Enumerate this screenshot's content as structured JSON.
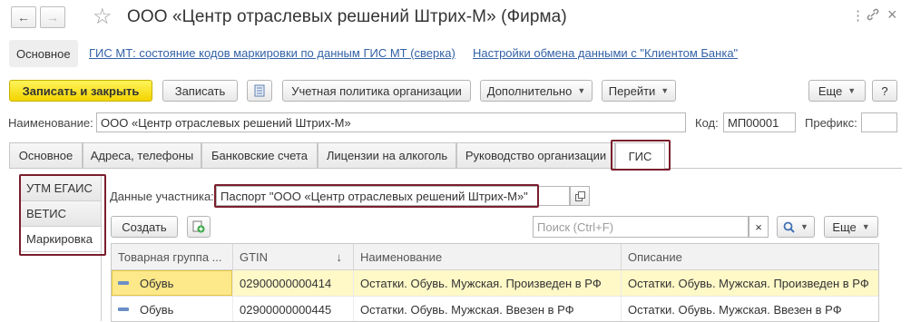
{
  "window": {
    "title": "ООО «Центр отраслевых решений Штрих-М» (Фирма)"
  },
  "sections": {
    "main": "Основное",
    "links": [
      "ГИС МТ: состояние кодов маркировки по данным ГИС МТ (сверка)",
      "Настройки обмена данными с \"Клиентом Банка\""
    ]
  },
  "toolbar": {
    "save_close": "Записать и закрыть",
    "save": "Записать",
    "accounting_policy": "Учетная политика организации",
    "more": "Дополнительно",
    "goto": "Перейти",
    "etc": "Еще",
    "help": "?"
  },
  "form": {
    "name_label": "Наименование:",
    "name_value": "ООО «Центр отраслевых решений Штрих-М»",
    "code_label": "Код:",
    "code_value": "МП00001",
    "prefix_label": "Префикс:",
    "prefix_value": ""
  },
  "tabs": [
    "Основное",
    "Адреса, телефоны",
    "Банковские счета",
    "Лицензии на алкоголь",
    "Руководство организации",
    "ГИС"
  ],
  "vtabs": [
    "УТМ ЕГАИС",
    "ВЕТИС",
    "Маркировка"
  ],
  "participant": {
    "label": "Данные участника:",
    "value": "Паспорт \"ООО «Центр отраслевых решений Штрих-М»\""
  },
  "list_toolbar": {
    "create": "Создать",
    "search_placeholder": "Поиск (Ctrl+F)",
    "etc": "Еще"
  },
  "table": {
    "columns": [
      "Товарная группа ...",
      "GTIN",
      "Наименование",
      "Описание"
    ],
    "sort_indicator": "↓",
    "rows": [
      [
        "Обувь",
        "02900000000414",
        "Остатки. Обувь. Мужская. Произведен в РФ",
        "Остатки. Обувь. Мужская. Произведен в РФ"
      ],
      [
        "Обувь",
        "02900000000445",
        "Остатки. Обувь. Мужская. Ввезен в РФ",
        "Остатки. Обувь. Мужская. Ввезен в РФ"
      ]
    ]
  },
  "icons": {
    "back": "←",
    "forward": "→",
    "favorite": "☆",
    "menu": "⋮",
    "link": "🔗",
    "close": "×"
  },
  "colors": {
    "primary_button": "#f2d400",
    "link": "#3362a7",
    "highlight_frame": "#7a1e2c",
    "selected_row": "#fff8c7"
  }
}
